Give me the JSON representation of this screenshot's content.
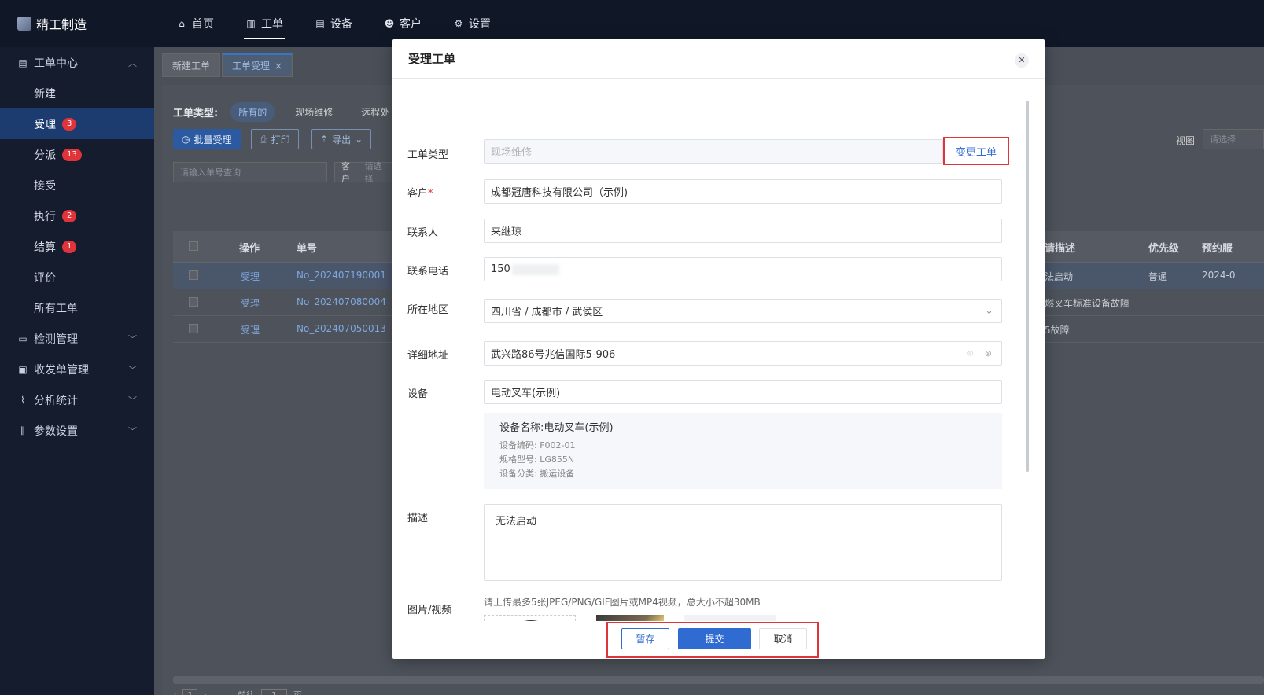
{
  "app": {
    "title": "精工制造"
  },
  "nav": {
    "items": [
      {
        "label": "首页",
        "icon": "home-icon"
      },
      {
        "label": "工单",
        "icon": "workorder-icon"
      },
      {
        "label": "设备",
        "icon": "device-icon"
      },
      {
        "label": "客户",
        "icon": "customer-icon"
      },
      {
        "label": "设置",
        "icon": "gear-icon"
      }
    ],
    "active": "工单"
  },
  "sidebar": {
    "group_workorder": "工单中心",
    "items": [
      {
        "label": "新建",
        "badge": ""
      },
      {
        "label": "受理",
        "badge": "3"
      },
      {
        "label": "分派",
        "badge": "13"
      },
      {
        "label": "接受",
        "badge": ""
      },
      {
        "label": "执行",
        "badge": "2"
      },
      {
        "label": "结算",
        "badge": "1"
      },
      {
        "label": "评价",
        "badge": ""
      },
      {
        "label": "所有工单",
        "badge": ""
      }
    ],
    "groups": [
      "检测管理",
      "收发单管理",
      "分析统计",
      "参数设置"
    ]
  },
  "tabs": [
    {
      "label": "新建工单"
    },
    {
      "label": "工单受理"
    }
  ],
  "filter": {
    "type_label": "工单类型:",
    "chips": [
      "所有的",
      "现场维修",
      "远程处"
    ],
    "batch_accept": "批量受理",
    "print": "打印",
    "export": "导出",
    "search_placeholder": "请输入单号查询",
    "customer_label": "客户",
    "customer_placeholder": "请选择",
    "view_label": "视图",
    "view_placeholder": "请选择"
  },
  "table": {
    "headers": {
      "op": "操作",
      "no": "单号",
      "desc": "请描述",
      "priority": "优先级",
      "appoint": "预约服"
    },
    "rows": [
      {
        "op": "受理",
        "no": "No_202407190001",
        "desc": "法启动",
        "priority": "普通",
        "appoint": "2024-0"
      },
      {
        "op": "受理",
        "no": "No_202407080004",
        "desc": "燃叉车标准设备故障",
        "priority": "",
        "appoint": ""
      },
      {
        "op": "受理",
        "no": "No_202407050013",
        "desc": "5故障",
        "priority": "",
        "appoint": ""
      }
    ]
  },
  "pagination": {
    "goto": "前往",
    "page": "1",
    "unit": "页"
  },
  "modal": {
    "title": "受理工单",
    "fields": {
      "type_label": "工单类型",
      "type_value": "现场维修",
      "change_link": "变更工单",
      "customer_label": "客户",
      "customer_value": "成都冠唐科技有限公司（示例)",
      "contact_label": "联系人",
      "contact_value": "来继琼",
      "phone_label": "联系电话",
      "phone_value": "150",
      "region_label": "所在地区",
      "region_value": "四川省 / 成都市 / 武侯区",
      "address_label": "详细地址",
      "address_value": "武兴路86号兆信国际5-906",
      "device_label": "设备",
      "device_value": "电动叉车(示例)",
      "desc_label": "描述",
      "desc_value": "无法启动",
      "media_label": "图片/视频",
      "media_hint": "请上传最多5张JPEG/PNG/GIF图片或MP4视频，总大小不超30MB"
    },
    "device_card": {
      "name": "设备名称:电动叉车(示例)",
      "code": "设备编码: F002-01",
      "model": "规格型号: LG855N",
      "category": "设备分类: 搬运设备"
    },
    "footer": {
      "save": "暂存",
      "submit": "提交",
      "cancel": "取消"
    }
  },
  "colors": {
    "primary": "#2f6bd0",
    "highlight": "#e0333a",
    "sidebar_active": "#1c3b6e"
  }
}
